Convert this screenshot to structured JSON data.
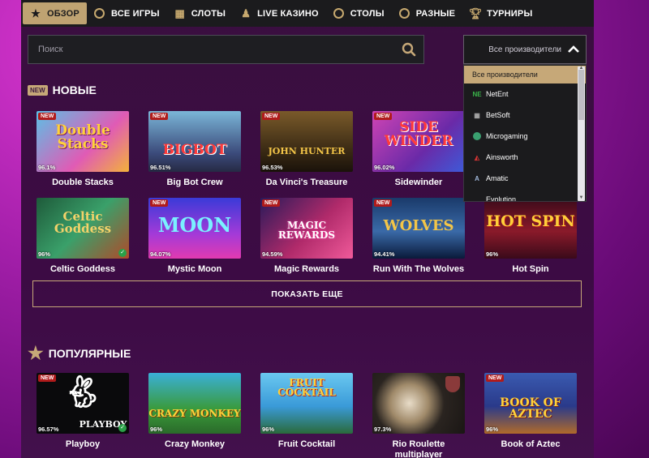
{
  "nav": [
    {
      "label": "ОБЗОР",
      "icon": "star-icon"
    },
    {
      "label": "ВСЕ ИГРЫ",
      "icon": "chip-icon"
    },
    {
      "label": "СЛОТЫ",
      "icon": "slot-icon"
    },
    {
      "label": "LIVE КАЗИНО",
      "icon": "person-icon"
    },
    {
      "label": "СТОЛЫ",
      "icon": "roulette-icon"
    },
    {
      "label": "РАЗНЫЕ",
      "icon": "dice-icon"
    },
    {
      "label": "ТУРНИРЫ",
      "icon": "trophy-icon"
    }
  ],
  "search": {
    "placeholder": "Поиск"
  },
  "providers": {
    "button_label": "Все производители",
    "items": [
      "Все производители",
      "NetEnt",
      "BetSoft",
      "Microgaming",
      "Ainsworth",
      "Amatic",
      "Evolution"
    ]
  },
  "sections": {
    "new_badge": "NEW",
    "new_title": "НОВЫЕ",
    "popular_title": "ПОПУЛЯРНЫЕ"
  },
  "new_games": [
    {
      "title": "Double Stacks",
      "rtp": "96.1%",
      "art": "Double Stacks"
    },
    {
      "title": "Big Bot Crew",
      "rtp": "96.51%",
      "art": "BIGBOT"
    },
    {
      "title": "Da Vinci's Treasure",
      "rtp": "96.53%",
      "art": "JOHN HUNTER"
    },
    {
      "title": "Sidewinder",
      "rtp": "96.02%",
      "art": "SIDE WINDER"
    },
    {
      "title": "Celtic Goddess",
      "rtp": "96%",
      "art": "Celtic Goddess"
    },
    {
      "title": "Mystic Moon",
      "rtp": "94.07%",
      "art": "MOON"
    },
    {
      "title": "Magic Rewards",
      "rtp": "94.59%",
      "art": "MAGIC REWARDS"
    },
    {
      "title": "Run With The Wolves",
      "rtp": "94.41%",
      "art": "WOLVES"
    },
    {
      "title": "Hot Spin",
      "rtp": "96%",
      "art": "HOT SPIN"
    }
  ],
  "show_more": "ПОКАЗАТЬ ЕЩЕ",
  "popular_games": [
    {
      "title": "Playboy",
      "rtp": "96.57%",
      "art": "PLAYBOY"
    },
    {
      "title": "Crazy Monkey",
      "rtp": "96%",
      "art": "CRAZY MONKEY"
    },
    {
      "title": "Fruit Cocktail",
      "rtp": "96%",
      "art": "FRUIT COCKTAIL"
    },
    {
      "title": "Rio Roulette multiplayer",
      "rtp": "97.3%",
      "art": ""
    },
    {
      "title": "Book of Aztec",
      "rtp": "96%",
      "art": "BOOK OF AZTEC"
    }
  ],
  "tag_new": "NEW",
  "colors": {
    "accent": "#c6a878",
    "nav_bg": "#1b1b1d",
    "tag_red": "#b01b1b"
  }
}
